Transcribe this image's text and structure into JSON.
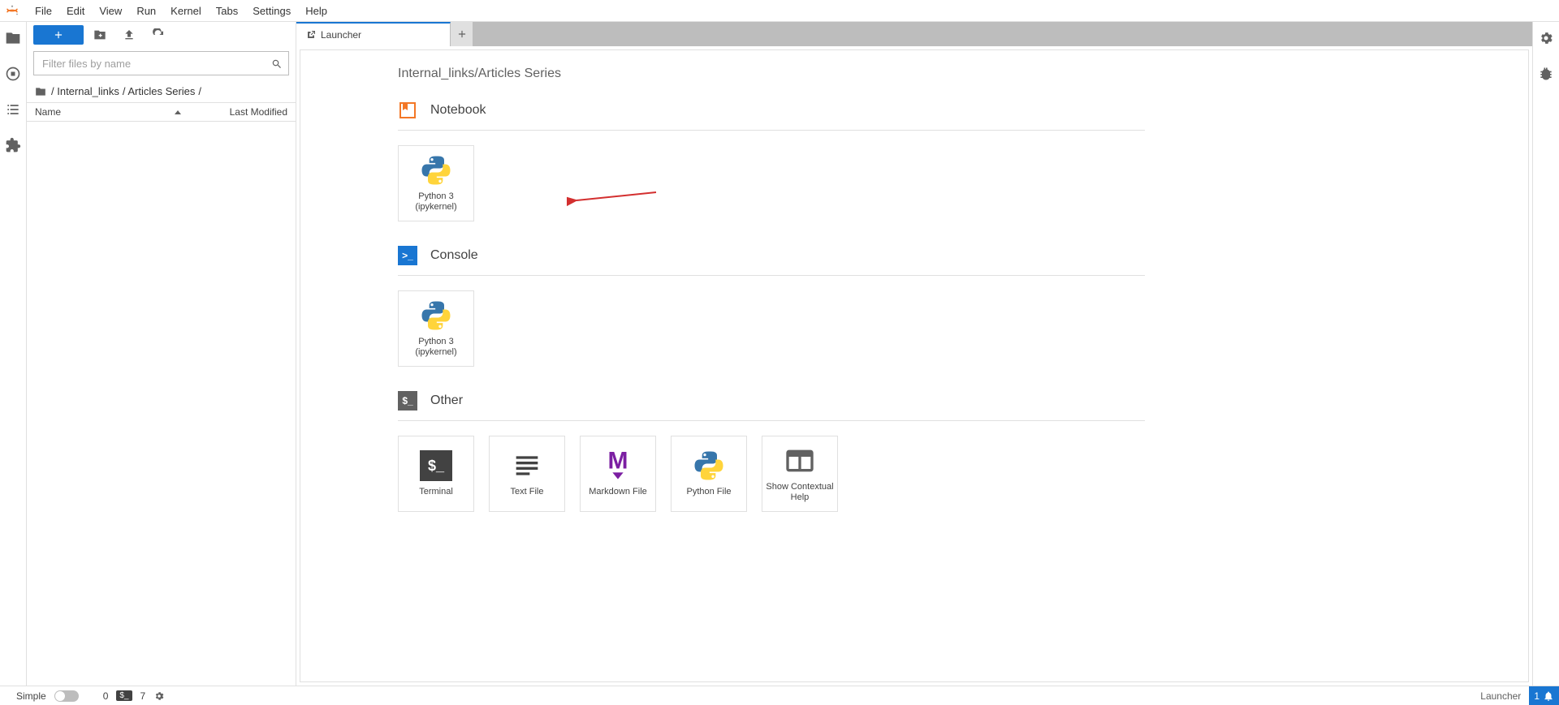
{
  "menubar": {
    "items": [
      "File",
      "Edit",
      "View",
      "Run",
      "Kernel",
      "Tabs",
      "Settings",
      "Help"
    ]
  },
  "filebrowser": {
    "filter_placeholder": "Filter files by name",
    "breadcrumb_parts": [
      "/ Internal_links",
      "/ Articles Series",
      "/"
    ],
    "header_name": "Name",
    "header_modified": "Last Modified"
  },
  "tab": {
    "title": "Launcher"
  },
  "launcher": {
    "cwd": "Internal_links/Articles Series",
    "sections": {
      "notebook": {
        "title": "Notebook",
        "cards": [
          {
            "label": "Python 3\n(ipykernel)"
          }
        ]
      },
      "console": {
        "title": "Console",
        "cards": [
          {
            "label": "Python 3\n(ipykernel)"
          }
        ]
      },
      "other": {
        "title": "Other",
        "cards": [
          {
            "label": "Terminal"
          },
          {
            "label": "Text File"
          },
          {
            "label": "Markdown File"
          },
          {
            "label": "Python File"
          },
          {
            "label": "Show Contextual\nHelp"
          }
        ]
      }
    }
  },
  "statusbar": {
    "simple_label": "Simple",
    "zero": "0",
    "terminals_count": "7",
    "right_label": "Launcher",
    "notif_count": "1"
  }
}
